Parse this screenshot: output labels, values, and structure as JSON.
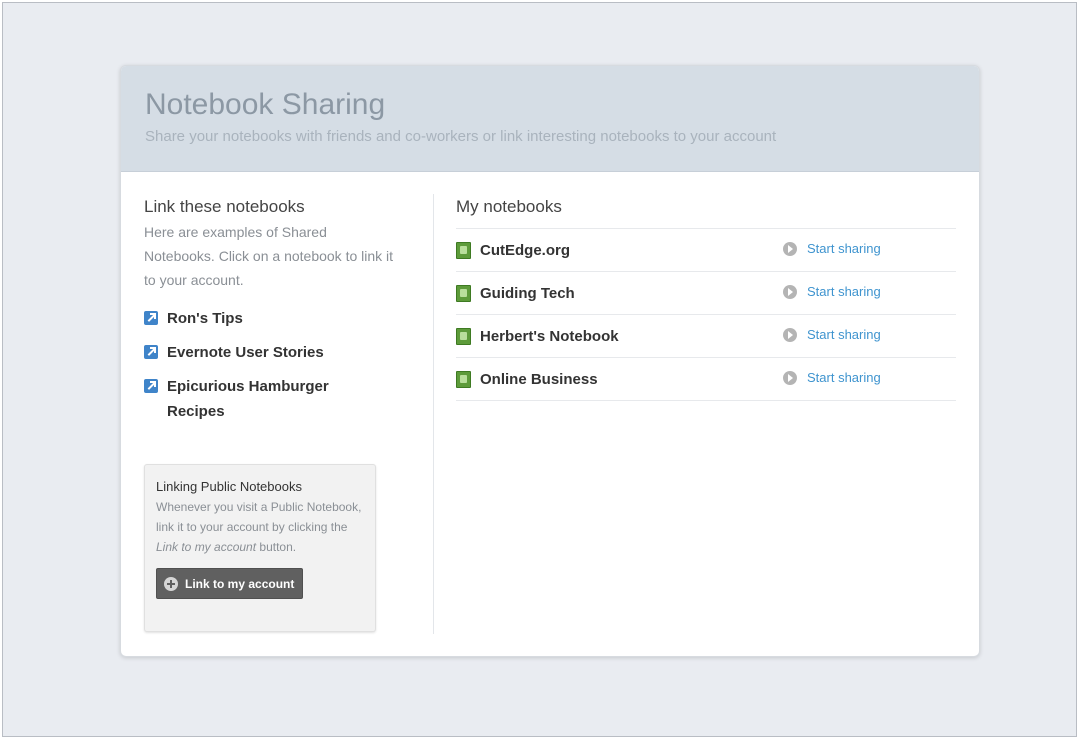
{
  "header": {
    "title": "Notebook Sharing",
    "subtitle": "Share your notebooks with friends and co-workers or link interesting notebooks to your account"
  },
  "left": {
    "heading": "Link these notebooks",
    "description": "Here are examples of Shared Notebooks. Click on a notebook to link it to your account.",
    "shared_notebooks": [
      {
        "label": "Ron's Tips",
        "icon": "link-arrow-icon"
      },
      {
        "label": "Evernote User Stories",
        "icon": "link-arrow-icon"
      },
      {
        "label": "Epicurious Hamburger Recipes",
        "icon": "link-arrow-icon"
      }
    ],
    "info_box": {
      "title": "Linking Public Notebooks",
      "text_before": "Whenever you visit a Public Notebook, link it to your account by clicking the ",
      "text_italic": "Link to my account",
      "text_after": " button.",
      "button_label": "Link to my account",
      "button_icon": "plus-circle-icon"
    }
  },
  "right": {
    "heading": "My notebooks",
    "notebooks": [
      {
        "name": "CutEdge.org",
        "action": "Start sharing",
        "icon": "notebook-icon"
      },
      {
        "name": "Guiding Tech",
        "action": "Start sharing",
        "icon": "notebook-icon"
      },
      {
        "name": "Herbert's Notebook",
        "action": "Start sharing",
        "icon": "notebook-icon"
      },
      {
        "name": "Online Business",
        "action": "Start sharing",
        "icon": "notebook-icon"
      }
    ]
  },
  "colors": {
    "header_bg": "#d5dde5",
    "title_text": "#8c98a4",
    "link_blue": "#3f94cf",
    "notebook_green": "#5d9b3a",
    "button_gray": "#606060"
  }
}
